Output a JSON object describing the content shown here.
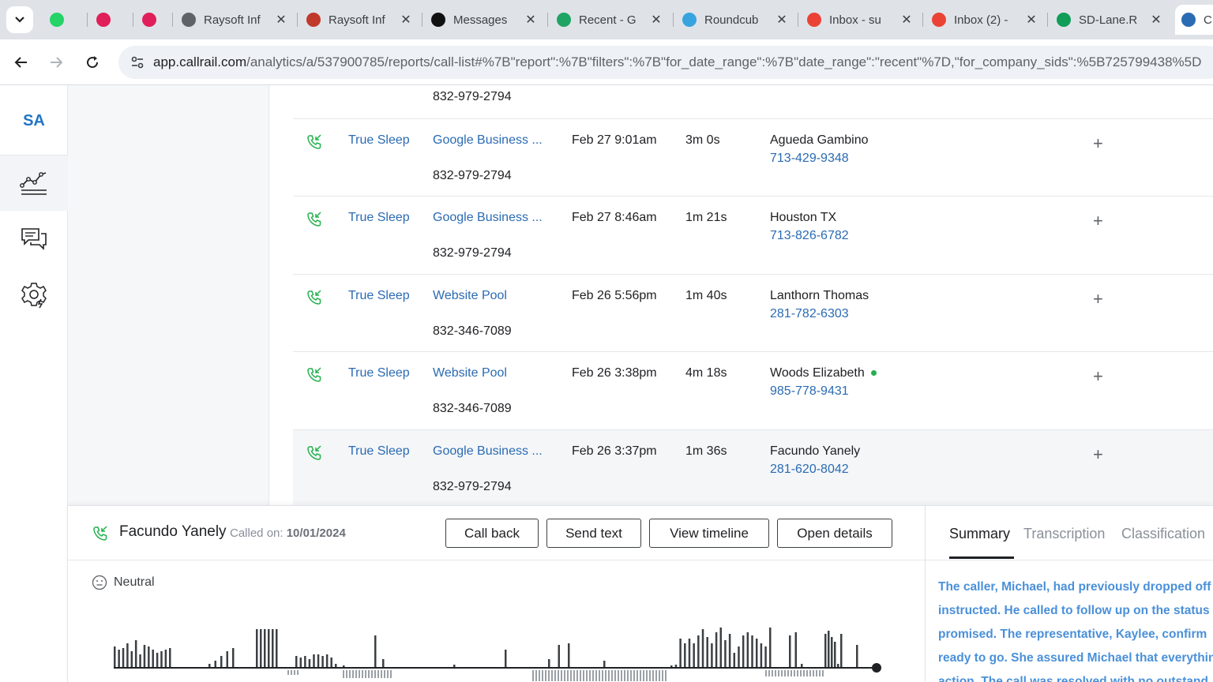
{
  "browser": {
    "tabs": [
      {
        "title": "",
        "icon": "whatsapp-icon",
        "color": "#25d366"
      },
      {
        "title": "",
        "icon": "slack-icon",
        "color": "#e01e5a"
      },
      {
        "title": "",
        "icon": "slack-icon",
        "color": "#e01e5a"
      },
      {
        "title": "Raysoft Inf",
        "icon": "globe-icon",
        "color": "#5f6368"
      },
      {
        "title": "Raysoft Inf",
        "icon": "raysoft-icon",
        "color": "#c0392b"
      },
      {
        "title": "Messages",
        "icon": "upwork-icon",
        "color": "#111111"
      },
      {
        "title": "Recent - G",
        "icon": "drive-icon",
        "color": "#1fa463"
      },
      {
        "title": "Roundcub",
        "icon": "roundcube-icon",
        "color": "#37a4e0"
      },
      {
        "title": "Inbox - su",
        "icon": "gmail-icon",
        "color": "#ea4335"
      },
      {
        "title": "Inbox (2) -",
        "icon": "gmail-icon",
        "color": "#ea4335"
      },
      {
        "title": "SD-Lane.R",
        "icon": "sheets-icon",
        "color": "#0f9d58"
      },
      {
        "title": "C",
        "icon": "callrail-icon",
        "color": "#2a6bb3"
      }
    ],
    "url_host": "app.callrail.com",
    "url_path": "/analytics/a/537900785/reports/call-list#%7B\"report\":%7B\"filters\":%7B\"for_date_range\":%7B\"date_range\":\"recent\"%7D,\"for_company_sids\":%5B725799438%5D"
  },
  "sidebar": {
    "logo": "SA",
    "items": [
      {
        "name": "analytics",
        "icon": "analytics-chart-icon",
        "active": true
      },
      {
        "name": "conversations",
        "icon": "chat-bubbles-icon",
        "active": false
      },
      {
        "name": "settings",
        "icon": "settings-gear-icon",
        "active": false
      }
    ]
  },
  "list": {
    "top_partial_tracking": "832-979-2794",
    "rows": [
      {
        "company": "True Sleep",
        "source": "Google Business ...",
        "tracking": "832-979-2794",
        "date": "Feb 27 9:01am",
        "duration": "3m 0s",
        "caller": "Agueda Gambino",
        "phone": "713-429-9348",
        "online": false
      },
      {
        "company": "True Sleep",
        "source": "Google Business ...",
        "tracking": "832-979-2794",
        "date": "Feb 27 8:46am",
        "duration": "1m 21s",
        "caller": "Houston TX",
        "phone": "713-826-6782",
        "online": false
      },
      {
        "company": "True Sleep",
        "source": "Website Pool",
        "tracking": "832-346-7089",
        "date": "Feb 26 5:56pm",
        "duration": "1m 40s",
        "caller": "Lanthorn Thomas",
        "phone": "281-782-6303",
        "online": false
      },
      {
        "company": "True Sleep",
        "source": "Website Pool",
        "tracking": "832-346-7089",
        "date": "Feb 26 3:38pm",
        "duration": "4m 18s",
        "caller": "Woods Elizabeth",
        "phone": "985-778-9431",
        "online": true
      },
      {
        "company": "True Sleep",
        "source": "Google Business ...",
        "tracking": "832-979-2794",
        "date": "Feb 26 3:37pm",
        "duration": "1m 36s",
        "caller": "Facundo Yanely",
        "phone": "281-620-8042",
        "online": false,
        "selected": true
      }
    ]
  },
  "detail": {
    "caller": "Facundo Yanely",
    "called_on_label": "Called on:",
    "called_on_date": "10/01/2024",
    "buttons": {
      "call_back": "Call back",
      "send_text": "Send text",
      "view_timeline": "View timeline",
      "open_details": "Open details"
    },
    "sentiment": "Neutral",
    "tabs": {
      "summary": "Summary",
      "transcription": "Transcription",
      "classification": "Classification"
    },
    "summary_lines": [
      "The caller, Michael, had previously dropped off",
      "instructed. He called to follow up on the status",
      "promised. The representative, Kaylee, confirm",
      "ready to go. She assured Michael that everythin",
      "action. The call was resolved with no outstand"
    ]
  },
  "colors": {
    "accent": "#2a6bb3",
    "online": "#22b14c",
    "summary_text": "#4a90d9"
  }
}
